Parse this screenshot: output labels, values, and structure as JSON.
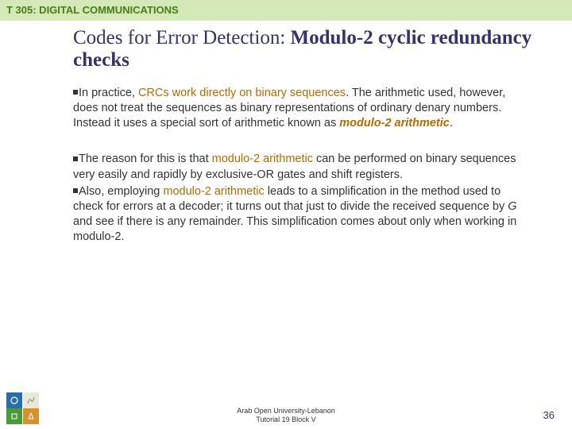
{
  "header": {
    "course": "T 305: DIGITAL COMMUNICATIONS"
  },
  "title": {
    "plain": "Codes for Error Detection: ",
    "bold": "Modulo-2 cyclic redundancy checks"
  },
  "bullets": {
    "p1a": "In practice, ",
    "p1b": "CRCs work directly on binary sequences",
    "p1c": ". The arithmetic used, however, does not treat the sequences as binary representations of ordinary denary numbers. Instead it uses a special sort of arithmetic known as ",
    "p1d": "modulo-2 arithmetic",
    "p1e": ".",
    "p2a": "The reason for this is that ",
    "p2b": "modulo-2 arithmetic",
    "p2c": " can be performed on binary sequences very easily and rapidly by exclusive-OR gates and shift registers.",
    "p3a": "Also, employing ",
    "p3b": "modulo-2 arithmetic",
    "p3c": " leads to a simplification in the method used to check for errors at a decoder; it turns out that just to divide the received sequence by ",
    "p3d": "G",
    "p3e": " and see if there is any remainder. This simplification comes about only when working in modulo-2."
  },
  "footer": {
    "org1": "Arab Open University-Lebanon",
    "org2": "Tutorial 19 Block V",
    "page": "36"
  }
}
